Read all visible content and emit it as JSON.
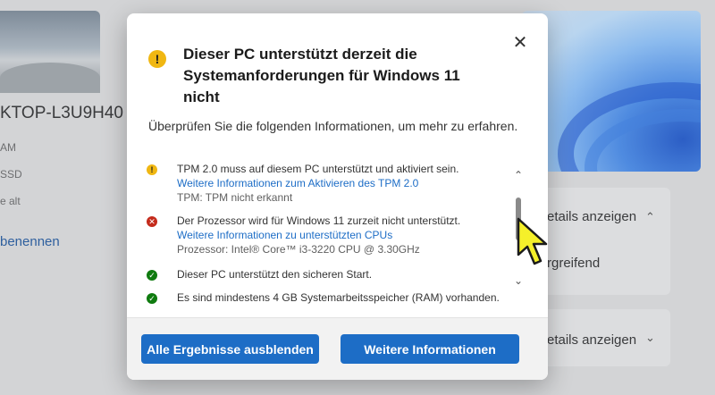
{
  "background": {
    "pc_name": "KTOP-L3U9H40",
    "specs": [
      "AM",
      "SSD",
      "e alt"
    ],
    "rename_link": "benennen",
    "right_rows": [
      {
        "label": "etails anzeigen",
        "chevron": "chevron-up-icon"
      },
      {
        "label": "rgreifend",
        "chevron": ""
      },
      {
        "label": "etails anzeigen",
        "chevron": "chevron-down-icon"
      }
    ]
  },
  "dialog": {
    "icon": "warning-icon",
    "title": "Dieser PC unterstützt derzeit die Systemanforderungen für Windows 11 nicht",
    "subtitle": "Überprüfen Sie die folgenden Informationen, um mehr zu erfahren.",
    "items": [
      {
        "status": "warning",
        "text": "TPM 2.0 muss auf diesem PC unterstützt und aktiviert sein.",
        "link": "Weitere Informationen zum Aktivieren des TPM 2.0",
        "info": "TPM: TPM nicht erkannt"
      },
      {
        "status": "error",
        "text": "Der Prozessor wird für Windows 11 zurzeit nicht unterstützt.",
        "link": "Weitere Informationen zu unterstützten CPUs",
        "info": "Prozessor: Intel® Core™ i3-3220 CPU @ 3.30GHz"
      },
      {
        "status": "ok",
        "text": "Dieser PC unterstützt den sicheren Start.",
        "link": "",
        "info": ""
      },
      {
        "status": "ok",
        "text": "Es sind mindestens 4 GB Systemarbeitsspeicher (RAM) vorhanden.",
        "link": "",
        "info": ""
      }
    ],
    "buttons": {
      "hide_all": "Alle Ergebnisse ausblenden",
      "more_info": "Weitere Informationen"
    }
  },
  "colors": {
    "accent": "#1d6dc6",
    "warning": "#f0b712",
    "error": "#c42b1c",
    "ok": "#0f7b0f",
    "cursor": "#f5f02a"
  }
}
